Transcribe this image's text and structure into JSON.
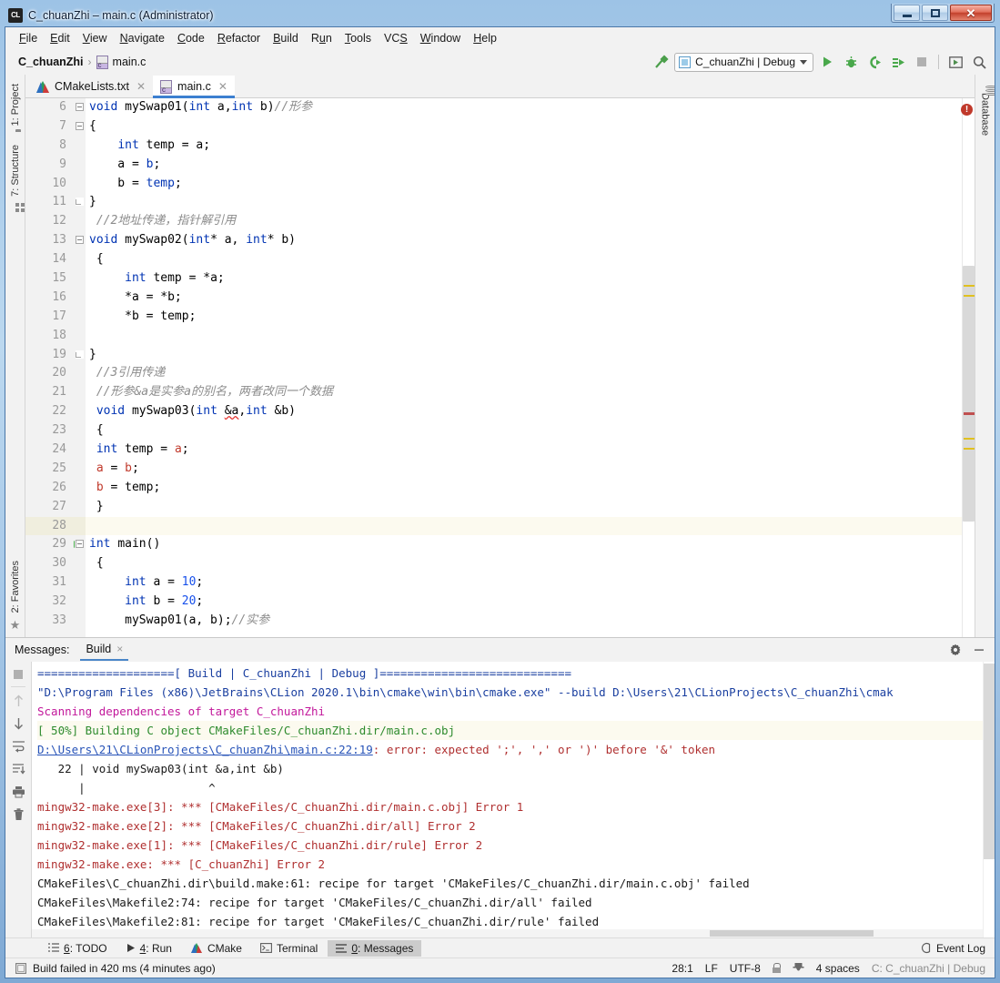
{
  "window": {
    "title": "C_chuanZhi – main.c (Administrator)",
    "app_icon": "clion-icon",
    "minimize": "minimize-button",
    "maximize": "maximize-button",
    "close": "close-button"
  },
  "menubar": {
    "items": [
      {
        "label": "File",
        "mnemonic": "F"
      },
      {
        "label": "Edit",
        "mnemonic": "E"
      },
      {
        "label": "View",
        "mnemonic": "V"
      },
      {
        "label": "Navigate",
        "mnemonic": "N"
      },
      {
        "label": "Code",
        "mnemonic": "C"
      },
      {
        "label": "Refactor",
        "mnemonic": "R"
      },
      {
        "label": "Build",
        "mnemonic": "B"
      },
      {
        "label": "Run",
        "mnemonic": "u"
      },
      {
        "label": "Tools",
        "mnemonic": "T"
      },
      {
        "label": "VCS",
        "mnemonic": "S"
      },
      {
        "label": "Window",
        "mnemonic": "W"
      },
      {
        "label": "Help",
        "mnemonic": "H"
      }
    ]
  },
  "breadcrumb": {
    "project": "C_chuanZhi",
    "separator": "›",
    "file": "main.c"
  },
  "toolbar": {
    "hammer": "build-hammer-icon",
    "run_config": "C_chuanZhi | Debug",
    "run": "run-icon",
    "debug": "debug-icon",
    "run_coverage": "run-with-coverage-icon",
    "attach": "attach-to-process-icon",
    "stop": "stop-icon",
    "updates": "update-icon",
    "search": "search-everywhere-icon"
  },
  "left_strip": {
    "project_tab": "1: Project",
    "structure_tab": "7: Structure",
    "favorites_tab": "2: Favorites"
  },
  "right_strip": {
    "database_tab": "Database"
  },
  "editor_tabs": [
    {
      "label": "CMakeLists.txt",
      "icon": "cmake-icon",
      "active": false
    },
    {
      "label": "main.c",
      "icon": "c-file-icon",
      "active": true
    }
  ],
  "editor": {
    "first_line": 6,
    "error_badge": "!",
    "lines": [
      {
        "n": 6,
        "fold": "start",
        "run": false,
        "hl": false,
        "tokens": [
          {
            "t": "void ",
            "c": "kw"
          },
          {
            "t": "mySwap01",
            "c": "fn"
          },
          {
            "t": "(",
            "c": ""
          },
          {
            "t": "int",
            "c": "kw"
          },
          {
            "t": " a,",
            "c": ""
          },
          {
            "t": "int",
            "c": "kw"
          },
          {
            "t": " b)",
            "c": ""
          },
          {
            "t": "//形参",
            "c": "cmt"
          }
        ],
        "indent": 0
      },
      {
        "n": 7,
        "fold": "open",
        "run": false,
        "hl": false,
        "tokens": [
          {
            "t": "{",
            "c": ""
          }
        ],
        "indent": 0
      },
      {
        "n": 8,
        "fold": "",
        "run": false,
        "hl": false,
        "tokens": [
          {
            "t": "    ",
            "c": ""
          },
          {
            "t": "int",
            "c": "kw"
          },
          {
            "t": " temp = a;",
            "c": ""
          }
        ],
        "indent": 0
      },
      {
        "n": 9,
        "fold": "",
        "run": false,
        "hl": false,
        "tokens": [
          {
            "t": "    a = ",
            "c": ""
          },
          {
            "t": "b",
            "c": "kw"
          },
          {
            "t": ";",
            "c": ""
          }
        ],
        "indent": 0
      },
      {
        "n": 10,
        "fold": "",
        "run": false,
        "hl": false,
        "tokens": [
          {
            "t": "    b = ",
            "c": ""
          },
          {
            "t": "temp",
            "c": "kw"
          },
          {
            "t": ";",
            "c": ""
          }
        ],
        "indent": 0
      },
      {
        "n": 11,
        "fold": "close",
        "run": false,
        "hl": false,
        "tokens": [
          {
            "t": "}",
            "c": ""
          }
        ],
        "indent": 0
      },
      {
        "n": 12,
        "fold": "",
        "run": false,
        "hl": false,
        "tokens": [
          {
            "t": " //2地址传递，指针解引用",
            "c": "cmt"
          }
        ],
        "indent": 0
      },
      {
        "n": 13,
        "fold": "open",
        "run": false,
        "hl": false,
        "tokens": [
          {
            "t": "void ",
            "c": "kw"
          },
          {
            "t": "mySwap02",
            "c": "fn"
          },
          {
            "t": "(",
            "c": ""
          },
          {
            "t": "int",
            "c": "kw"
          },
          {
            "t": "* a, ",
            "c": ""
          },
          {
            "t": "int",
            "c": "kw"
          },
          {
            "t": "* b)",
            "c": ""
          }
        ],
        "indent": 0
      },
      {
        "n": 14,
        "fold": "",
        "run": false,
        "hl": false,
        "tokens": [
          {
            "t": " {",
            "c": ""
          }
        ],
        "indent": 0
      },
      {
        "n": 15,
        "fold": "",
        "run": false,
        "hl": false,
        "tokens": [
          {
            "t": "     ",
            "c": ""
          },
          {
            "t": "int",
            "c": "kw"
          },
          {
            "t": " temp = *a;",
            "c": ""
          }
        ],
        "indent": 0
      },
      {
        "n": 16,
        "fold": "",
        "run": false,
        "hl": false,
        "tokens": [
          {
            "t": "     *a = *b;",
            "c": ""
          }
        ],
        "indent": 0
      },
      {
        "n": 17,
        "fold": "",
        "run": false,
        "hl": false,
        "tokens": [
          {
            "t": "     *b = temp;",
            "c": ""
          }
        ],
        "indent": 0
      },
      {
        "n": 18,
        "fold": "",
        "run": false,
        "hl": false,
        "tokens": [
          {
            "t": "",
            "c": ""
          }
        ],
        "indent": 0
      },
      {
        "n": 19,
        "fold": "close",
        "run": false,
        "hl": false,
        "tokens": [
          {
            "t": "}",
            "c": ""
          }
        ],
        "indent": 0
      },
      {
        "n": 20,
        "fold": "",
        "run": false,
        "hl": false,
        "tokens": [
          {
            "t": " //3引用传递",
            "c": "cmt"
          }
        ],
        "indent": 0
      },
      {
        "n": 21,
        "fold": "",
        "run": false,
        "hl": false,
        "tokens": [
          {
            "t": " //形参&a是实参a的别名，两者改同一个数据",
            "c": "cmt"
          }
        ],
        "indent": 0
      },
      {
        "n": 22,
        "fold": "",
        "run": false,
        "hl": false,
        "tokens": [
          {
            "t": " ",
            "c": ""
          },
          {
            "t": "void ",
            "c": "kw"
          },
          {
            "t": "mySwap03",
            "c": "fn"
          },
          {
            "t": "(",
            "c": ""
          },
          {
            "t": "int",
            "c": "kw"
          },
          {
            "t": " ",
            "c": ""
          },
          {
            "t": "&a",
            "c": "errwave"
          },
          {
            "t": ",",
            "c": ""
          },
          {
            "t": "int",
            "c": "kw"
          },
          {
            "t": " &b)",
            "c": ""
          }
        ],
        "indent": 0
      },
      {
        "n": 23,
        "fold": "",
        "run": false,
        "hl": false,
        "tokens": [
          {
            "t": " {",
            "c": ""
          }
        ],
        "indent": 0
      },
      {
        "n": 24,
        "fold": "",
        "run": false,
        "hl": false,
        "tokens": [
          {
            "t": " ",
            "c": ""
          },
          {
            "t": "int",
            "c": "kw"
          },
          {
            "t": " temp = ",
            "c": ""
          },
          {
            "t": "a",
            "c": "red"
          },
          {
            "t": ";",
            "c": ""
          }
        ],
        "indent": 0
      },
      {
        "n": 25,
        "fold": "",
        "run": false,
        "hl": false,
        "tokens": [
          {
            "t": " ",
            "c": ""
          },
          {
            "t": "a",
            "c": "red"
          },
          {
            "t": " = ",
            "c": ""
          },
          {
            "t": "b",
            "c": "red"
          },
          {
            "t": ";",
            "c": ""
          }
        ],
        "indent": 0
      },
      {
        "n": 26,
        "fold": "",
        "run": false,
        "hl": false,
        "tokens": [
          {
            "t": " ",
            "c": ""
          },
          {
            "t": "b",
            "c": "red"
          },
          {
            "t": " = temp;",
            "c": ""
          }
        ],
        "indent": 0
      },
      {
        "n": 27,
        "fold": "",
        "run": false,
        "hl": false,
        "tokens": [
          {
            "t": " }",
            "c": ""
          }
        ],
        "indent": 0
      },
      {
        "n": 28,
        "fold": "",
        "run": false,
        "hl": true,
        "tokens": [
          {
            "t": "",
            "c": ""
          }
        ],
        "indent": 0
      },
      {
        "n": 29,
        "fold": "open",
        "run": true,
        "hl": false,
        "tokens": [
          {
            "t": "int ",
            "c": "kw"
          },
          {
            "t": "main",
            "c": "fn"
          },
          {
            "t": "()",
            "c": ""
          }
        ],
        "indent": 0
      },
      {
        "n": 30,
        "fold": "",
        "run": false,
        "hl": false,
        "tokens": [
          {
            "t": " {",
            "c": ""
          }
        ],
        "indent": 0
      },
      {
        "n": 31,
        "fold": "",
        "run": false,
        "hl": false,
        "tokens": [
          {
            "t": "     ",
            "c": ""
          },
          {
            "t": "int",
            "c": "kw"
          },
          {
            "t": " a = ",
            "c": ""
          },
          {
            "t": "10",
            "c": "num"
          },
          {
            "t": ";",
            "c": ""
          }
        ],
        "indent": 0
      },
      {
        "n": 32,
        "fold": "",
        "run": false,
        "hl": false,
        "tokens": [
          {
            "t": "     ",
            "c": ""
          },
          {
            "t": "int",
            "c": "kw"
          },
          {
            "t": " b = ",
            "c": ""
          },
          {
            "t": "20",
            "c": "num"
          },
          {
            "t": ";",
            "c": ""
          }
        ],
        "indent": 0
      },
      {
        "n": 33,
        "fold": "",
        "run": false,
        "hl": false,
        "tokens": [
          {
            "t": "     mySwap01(a, b);",
            "c": ""
          },
          {
            "t": "//实参",
            "c": "cmt"
          }
        ],
        "indent": 0
      }
    ]
  },
  "messages_panel": {
    "label": "Messages:",
    "tab": "Build",
    "tab_close": "×",
    "settings_icon": "gear-icon",
    "hide_icon": "minimize-icon",
    "tools": [
      "stop-icon",
      "up-arrow-icon",
      "down-arrow-icon",
      "soft-wrap-icon",
      "scroll-to-end-icon",
      "print-icon",
      "trash-icon"
    ],
    "lines": [
      {
        "hl": false,
        "parts": [
          {
            "t": "====================[ Build | C_chuanZhi | Debug ]============================",
            "c": "c-blue"
          }
        ]
      },
      {
        "hl": false,
        "parts": [
          {
            "t": "\"D:\\Program Files (x86)\\JetBrains\\CLion 2020.1\\bin\\cmake\\win\\bin\\cmake.exe\" --build D:\\Users\\21\\CLionProjects\\C_chuanZhi\\cmak",
            "c": "c-blue"
          }
        ]
      },
      {
        "hl": false,
        "parts": [
          {
            "t": "Scanning dependencies of target C_chuanZhi",
            "c": "c-mag"
          }
        ]
      },
      {
        "hl": true,
        "parts": [
          {
            "t": "[ 50%] Building C object CMakeFiles/C_chuanZhi.dir/main.c.obj",
            "c": "c-green"
          }
        ]
      },
      {
        "hl": false,
        "parts": [
          {
            "t": "D:\\Users\\21\\CLionProjects\\C_chuanZhi\\main.c:22:19",
            "c": "c-link"
          },
          {
            "t": ": error: expected ';', ',' or ')' before '&' token",
            "c": "c-red"
          }
        ]
      },
      {
        "hl": false,
        "parts": [
          {
            "t": "   22 | void mySwap03(int &a,int &b)",
            "c": "c-dark"
          }
        ]
      },
      {
        "hl": false,
        "parts": [
          {
            "t": "      |                  ^",
            "c": "c-dark"
          }
        ]
      },
      {
        "hl": false,
        "parts": [
          {
            "t": "mingw32-make.exe[3]: *** [CMakeFiles/C_chuanZhi.dir/main.c.obj] Error 1",
            "c": "c-red"
          }
        ]
      },
      {
        "hl": false,
        "parts": [
          {
            "t": "mingw32-make.exe[2]: *** [CMakeFiles/C_chuanZhi.dir/all] Error 2",
            "c": "c-red"
          }
        ]
      },
      {
        "hl": false,
        "parts": [
          {
            "t": "mingw32-make.exe[1]: *** [CMakeFiles/C_chuanZhi.dir/rule] Error 2",
            "c": "c-red"
          }
        ]
      },
      {
        "hl": false,
        "parts": [
          {
            "t": "mingw32-make.exe: *** [C_chuanZhi] Error 2",
            "c": "c-red"
          }
        ]
      },
      {
        "hl": false,
        "parts": [
          {
            "t": "CMakeFiles\\C_chuanZhi.dir\\build.make:61: recipe for target 'CMakeFiles/C_chuanZhi.dir/main.c.obj' failed",
            "c": "c-dark"
          }
        ]
      },
      {
        "hl": false,
        "parts": [
          {
            "t": "CMakeFiles\\Makefile2:74: recipe for target 'CMakeFiles/C_chuanZhi.dir/all' failed",
            "c": "c-dark"
          }
        ]
      },
      {
        "hl": false,
        "parts": [
          {
            "t": "CMakeFiles\\Makefile2:81: recipe for target 'CMakeFiles/C_chuanZhi.dir/rule' failed",
            "c": "c-dark"
          }
        ]
      }
    ]
  },
  "bottom_tools": [
    {
      "label": "6: TODO",
      "mnemonic": "6",
      "icon": "todo-icon",
      "active": false
    },
    {
      "label": "4: Run",
      "mnemonic": "4",
      "icon": "run-icon",
      "active": false
    },
    {
      "label": "CMake",
      "mnemonic": "",
      "icon": "cmake-icon",
      "active": false
    },
    {
      "label": "Terminal",
      "mnemonic": "",
      "icon": "terminal-icon",
      "active": false
    },
    {
      "label": "0: Messages",
      "mnemonic": "0",
      "icon": "messages-icon",
      "active": true
    }
  ],
  "event_log": "Event Log",
  "statusbar": {
    "build_status": "Build failed in 420 ms (4 minutes ago)",
    "caret": "28:1",
    "line_sep": "LF",
    "encoding": "UTF-8",
    "lock_icon": "lock-icon",
    "inspection_icon": "hector-inspection-icon",
    "indent": "4 spaces",
    "config": "C: C_chuanZhi | Debug"
  },
  "colors": {
    "accent_blue": "#3c7fd0",
    "keyword": "#0033b3",
    "comment": "#8c8c8c",
    "number": "#1750eb",
    "error_red": "#c0392b",
    "green_run": "#4caf50",
    "title_gradient_top": "#9dc3e6"
  }
}
